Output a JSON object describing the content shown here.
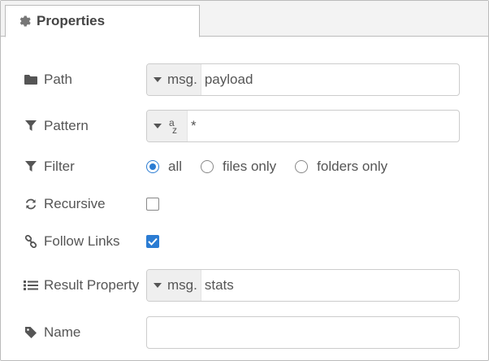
{
  "tab": {
    "label": "Properties",
    "icon": "gear-icon"
  },
  "fields": {
    "path": {
      "label": "Path",
      "icon": "folder-icon",
      "type_prefix": "msg.",
      "value": "payload"
    },
    "pattern": {
      "label": "Pattern",
      "icon": "filter-icon",
      "type_icon": "az-string-icon",
      "value": "*"
    },
    "filter": {
      "label": "Filter",
      "icon": "filter-icon",
      "options": [
        {
          "label": "all",
          "checked": true
        },
        {
          "label": "files only",
          "checked": false
        },
        {
          "label": "folders only",
          "checked": false
        }
      ]
    },
    "recursive": {
      "label": "Recursive",
      "icon": "refresh-icon",
      "checked": false
    },
    "follow_links": {
      "label": "Follow Links",
      "icon": "link-icon",
      "checked": true
    },
    "result_property": {
      "label": "Result Property",
      "icon": "list-icon",
      "type_prefix": "msg.",
      "value": "stats"
    },
    "name": {
      "label": "Name",
      "icon": "tag-icon",
      "value": "",
      "placeholder": ""
    }
  },
  "colors": {
    "accent": "#2b7cd3",
    "text": "#555555",
    "border": "#cccccc"
  }
}
